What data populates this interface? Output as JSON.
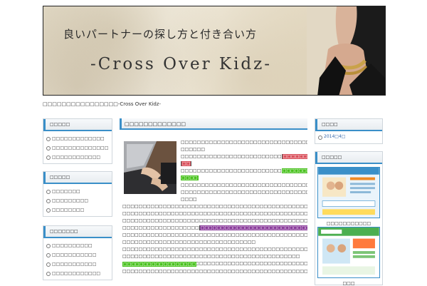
{
  "header": {
    "title_jp": "良いパートナーの探し方と付き合い方",
    "subtitle": "-Cross Over Kidz-"
  },
  "site_line": "□□□□□□□□□□□□□□□□-Cross Over Kidz-",
  "left_sidebar": {
    "boxes": [
      {
        "heading": "□□□□□",
        "items": [
          "□□□□□□□□□□□□□",
          "□□□□□□□□□□□□□□",
          "□□□□□□□□□□□□"
        ]
      },
      {
        "heading": "□□□□□",
        "items": [
          "□□□□□□□",
          "□□□□□□□□□",
          "□□□□□□□□"
        ]
      },
      {
        "heading": "□□□□□□□",
        "items": [
          "□□□□□□□□□□",
          "□□□□□□□□□□□",
          "□□□□□□□□□□□",
          "□□□□□□□□□□□□"
        ]
      }
    ]
  },
  "main": {
    "heading": "□□□□□□□□□□□□□",
    "lines": [
      "□□□□□□□□□□□□□□□□□□□□□□□□□□□□□□□□□□□□□□□□",
      "□□□□□□",
      "□□□□□□□□□□□□□□□□□□□□□□□□□",
      "□□□□□□□□□□□□□□□",
      "□□",
      "□□□□□□□□□□□□□□□□□□□□□□□□□",
      "□□□□□□□□□□□□□□□",
      "□□□□",
      "□□□□□□□□□□□□□□□□□□□□□□□□□□□□□□□□□□□□□□□□",
      "□□□□□□□□□□□□□□□□□□□□□□□□□□□□□□□□□□□□□□□□",
      "□□□□",
      "□□□□□□□□□□□□□□□□□□□□□□□□□□□□□□□□□□□□□□□□□□□□□□□□□□□□□□□□□□□□",
      "□□□□□□□□□□□□□□□□□□□□□□□□□□□□□□□□□□□□□□□□□□□□□□□□□□□□□□□□□□□□□□□□□□",
      "□□□□□□□□□□□□□□□□□□□□□□□□□□□□□□□□□□□□□□□□□□□□□□□□□□□",
      "□□□□□□□□□□□□□□□□□□□",
      "□□□□□□□□□□□□□□□□□□□□□□□□□□□□□□□□□□□□",
      "□",
      "□□□□□□□□□□□□□□□□□□□□□□□□□□□□□□□□□□□□□□□□□□□□□□□□□□□□□□□□□□□□□□□",
      "□□□□□□□□□□□□□□□□□□□□□□□□□□□□□□□□□",
      "□□□□□□□□□□□□□□□□□□□□□□□□□□□□□□□□□□□□□□□□□□□□□□□□□□□□□□□□□□□□□□",
      "□□□□□□□□□□□□□□□□□□□□□□□□□□□□□□□□□□□□□□□□□□□□",
      "□□□□□□□□□□□□□□□□□□□□□□□□□□□□□□□□□□□□□□□□□□□□□□□□□□□□□□□□□□□□□□□",
      "□□□□□□□□□□□□□□□□□□",
      "□□□□□□□□□□□□□□□□□□□□□□□□□□□□□□□□□□□□□□□□□□□□□□□□□□□"
    ]
  },
  "right_sidebar": {
    "archive_heading": "□□□□",
    "archive_item": "2014□4□",
    "ads_heading": "□□□□□",
    "ad_caption_1": "□□□□□□□□□□□",
    "ad_caption_2": "□□□"
  },
  "colors": {
    "accent": "#3a8fc8",
    "highlight_red": "#d9505b",
    "highlight_green": "#49c21e",
    "highlight_purple": "#8a3b9b"
  }
}
